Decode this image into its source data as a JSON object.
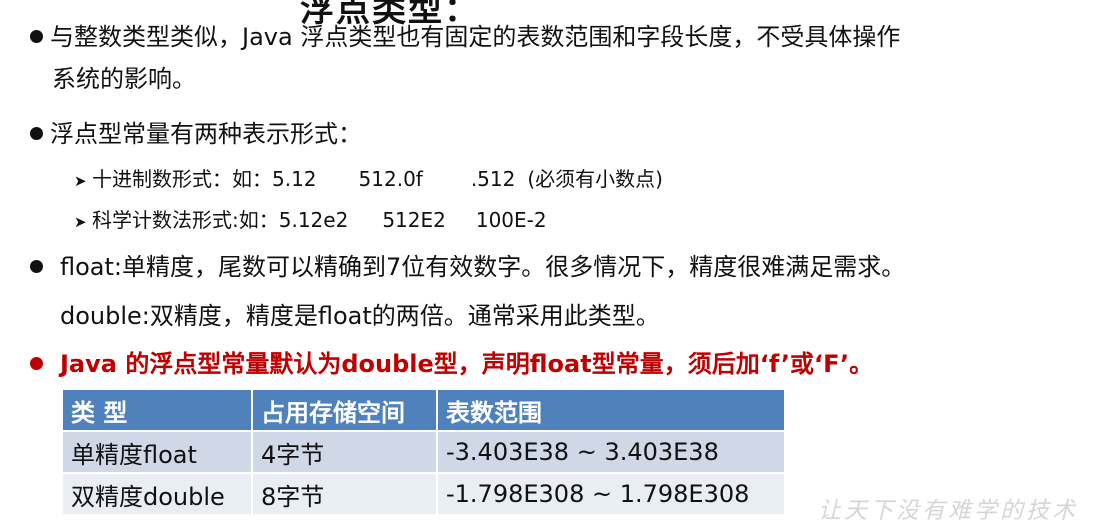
{
  "title_fragment": "浮点类型：",
  "bullets": [
    {
      "line1": "与整数类型类似，Java 浮点类型也有固定的表数范围和字段长度，不受具体操作",
      "line2": "系统的影响。"
    },
    {
      "text": "浮点型常量有两种表示形式：",
      "subs": [
        {
          "label": "十进制数形式：如：",
          "v1": "5.12",
          "v2": "512.0f",
          "v3": ".512",
          "note": "(必须有小数点)"
        },
        {
          "label": "科学计数法形式:如：",
          "v1": "5.12e2",
          "v2": "512E2",
          "v3": "100E-2"
        }
      ]
    },
    {
      "line1": "float:单精度，尾数可以精确到7位有效数字。很多情况下，精度很难满足需求。",
      "line2": "double:双精度，精度是float的两倍。通常采用此类型。"
    },
    {
      "text": "Java 的浮点型常量默认为double型，声明float型常量，须后加‘f’或‘F’。"
    }
  ],
  "table": {
    "headers": [
      "类  型",
      "占用存储空间",
      "表数范围"
    ],
    "rows": [
      [
        "单精度float",
        "4字节",
        "-3.403E38 ~ 3.403E38"
      ],
      [
        "双精度double",
        "8字节",
        "-1.798E308 ~ 1.798E308"
      ]
    ]
  },
  "watermark": "让天下没有难学的技术",
  "colors": {
    "header_bg": "#4f81bd",
    "row1_bg": "#d0d8e8",
    "row2_bg": "#e9edf4",
    "highlight_red": "#c00000"
  }
}
